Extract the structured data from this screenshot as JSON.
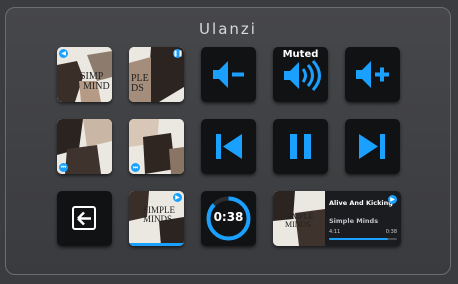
{
  "app": {
    "title": "Ulanzi"
  },
  "colors": {
    "accent": "#1aa0ff",
    "key_bg": "#111214",
    "panel": "#3b3c3f"
  },
  "keys": {
    "row1": [
      {
        "name": "album-art-1",
        "icon": "album-art",
        "badge": "volume-icon"
      },
      {
        "name": "album-art-2",
        "icon": "album-art",
        "badge": "pause-icon"
      },
      {
        "name": "volume-down",
        "icon": "volume-down-icon"
      },
      {
        "name": "mute-toggle",
        "icon": "volume-up-icon",
        "label": "Muted"
      },
      {
        "name": "volume-up",
        "icon": "volume-plus-icon"
      }
    ],
    "row2": [
      {
        "name": "album-art-3",
        "icon": "album-art",
        "badge": "previous-icon"
      },
      {
        "name": "album-art-4",
        "icon": "album-art",
        "badge": "next-icon"
      },
      {
        "name": "previous-track",
        "icon": "skip-previous-icon"
      },
      {
        "name": "play-pause",
        "icon": "pause-icon"
      },
      {
        "name": "next-track",
        "icon": "skip-next-icon"
      }
    ],
    "row3": [
      {
        "name": "back",
        "icon": "back-arrow-icon"
      },
      {
        "name": "album-art-5",
        "icon": "album-art",
        "badge": "play-icon"
      },
      {
        "name": "timer",
        "icon": "progress-ring",
        "time": "0:38"
      }
    ]
  },
  "now_playing": {
    "song": "Alive And Kicking",
    "artist": "Simple Minds",
    "elapsed": "4:11",
    "remaining": "0:38",
    "progress": 0.87,
    "album_text": "SIMPLE MINDS"
  }
}
